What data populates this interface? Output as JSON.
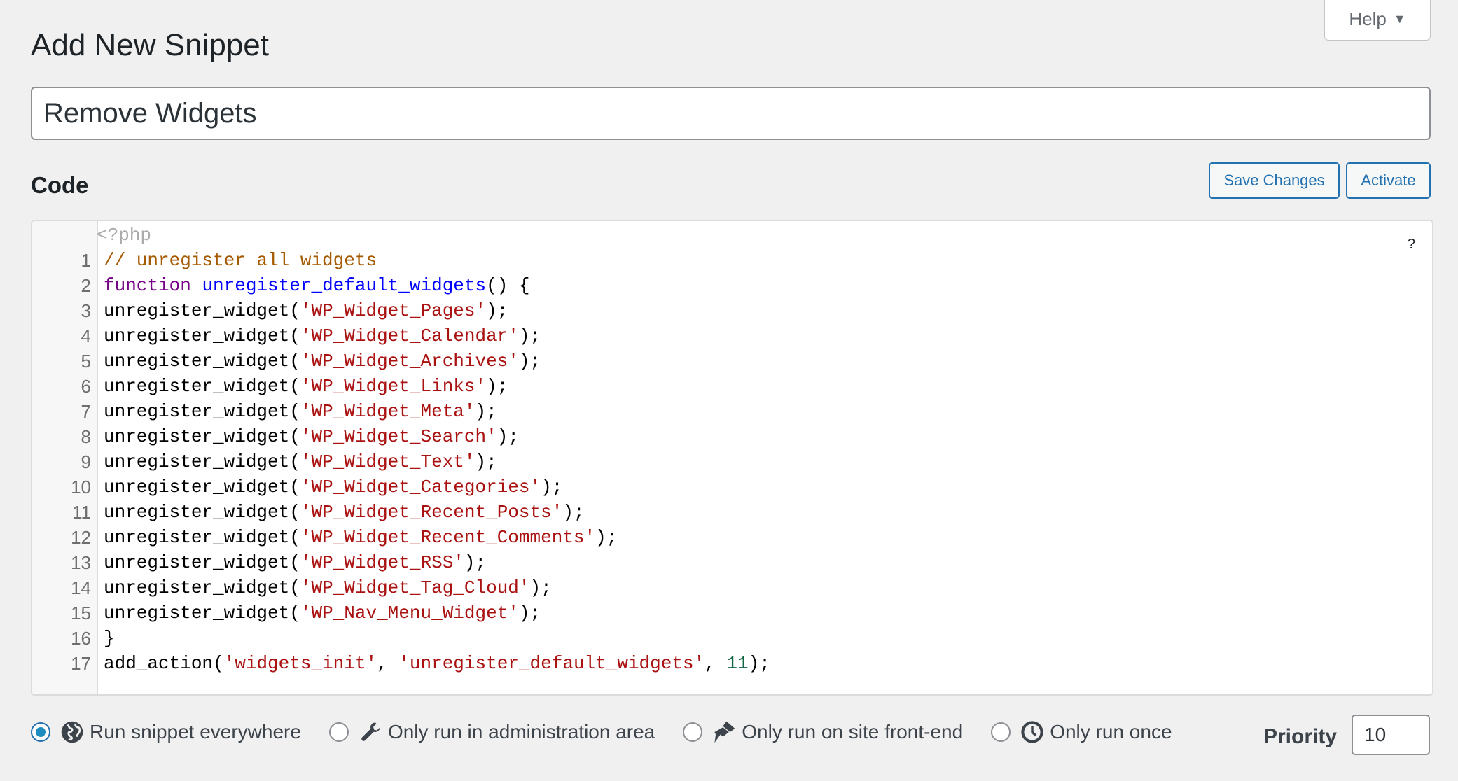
{
  "help": {
    "label": "Help",
    "arrow": "▼"
  },
  "page": {
    "title": "Add New Snippet"
  },
  "snippet": {
    "name": "Remove Widgets"
  },
  "code_section": {
    "heading": "Code",
    "save_label": "Save Changes",
    "activate_label": "Activate",
    "help_mark": "?"
  },
  "editor": {
    "opening_tag": "<?php",
    "lines": [
      {
        "n": "1",
        "tokens": [
          {
            "t": "// unregister all widgets",
            "c": "comment"
          }
        ]
      },
      {
        "n": "2",
        "tokens": [
          {
            "t": "function",
            "c": "keyword"
          },
          {
            "t": " ",
            "c": ""
          },
          {
            "t": "unregister_default_widgets",
            "c": "def"
          },
          {
            "t": "() {",
            "c": ""
          }
        ]
      },
      {
        "n": "3",
        "tokens": [
          {
            "t": "unregister_widget(",
            "c": ""
          },
          {
            "t": "'WP_Widget_Pages'",
            "c": "string"
          },
          {
            "t": ");",
            "c": ""
          }
        ]
      },
      {
        "n": "4",
        "tokens": [
          {
            "t": "unregister_widget(",
            "c": ""
          },
          {
            "t": "'WP_Widget_Calendar'",
            "c": "string"
          },
          {
            "t": ");",
            "c": ""
          }
        ]
      },
      {
        "n": "5",
        "tokens": [
          {
            "t": "unregister_widget(",
            "c": ""
          },
          {
            "t": "'WP_Widget_Archives'",
            "c": "string"
          },
          {
            "t": ");",
            "c": ""
          }
        ]
      },
      {
        "n": "6",
        "tokens": [
          {
            "t": "unregister_widget(",
            "c": ""
          },
          {
            "t": "'WP_Widget_Links'",
            "c": "string"
          },
          {
            "t": ");",
            "c": ""
          }
        ]
      },
      {
        "n": "7",
        "tokens": [
          {
            "t": "unregister_widget(",
            "c": ""
          },
          {
            "t": "'WP_Widget_Meta'",
            "c": "string"
          },
          {
            "t": ");",
            "c": ""
          }
        ]
      },
      {
        "n": "8",
        "tokens": [
          {
            "t": "unregister_widget(",
            "c": ""
          },
          {
            "t": "'WP_Widget_Search'",
            "c": "string"
          },
          {
            "t": ");",
            "c": ""
          }
        ]
      },
      {
        "n": "9",
        "tokens": [
          {
            "t": "unregister_widget(",
            "c": ""
          },
          {
            "t": "'WP_Widget_Text'",
            "c": "string"
          },
          {
            "t": ");",
            "c": ""
          }
        ]
      },
      {
        "n": "10",
        "tokens": [
          {
            "t": "unregister_widget(",
            "c": ""
          },
          {
            "t": "'WP_Widget_Categories'",
            "c": "string"
          },
          {
            "t": ");",
            "c": ""
          }
        ]
      },
      {
        "n": "11",
        "tokens": [
          {
            "t": "unregister_widget(",
            "c": ""
          },
          {
            "t": "'WP_Widget_Recent_Posts'",
            "c": "string"
          },
          {
            "t": ");",
            "c": ""
          }
        ]
      },
      {
        "n": "12",
        "tokens": [
          {
            "t": "unregister_widget(",
            "c": ""
          },
          {
            "t": "'WP_Widget_Recent_Comments'",
            "c": "string"
          },
          {
            "t": ");",
            "c": ""
          }
        ]
      },
      {
        "n": "13",
        "tokens": [
          {
            "t": "unregister_widget(",
            "c": ""
          },
          {
            "t": "'WP_Widget_RSS'",
            "c": "string"
          },
          {
            "t": ");",
            "c": ""
          }
        ]
      },
      {
        "n": "14",
        "tokens": [
          {
            "t": "unregister_widget(",
            "c": ""
          },
          {
            "t": "'WP_Widget_Tag_Cloud'",
            "c": "string"
          },
          {
            "t": ");",
            "c": ""
          }
        ]
      },
      {
        "n": "15",
        "tokens": [
          {
            "t": "unregister_widget(",
            "c": ""
          },
          {
            "t": "'WP_Nav_Menu_Widget'",
            "c": "string"
          },
          {
            "t": ");",
            "c": ""
          }
        ]
      },
      {
        "n": "16",
        "tokens": [
          {
            "t": "}",
            "c": ""
          }
        ]
      },
      {
        "n": "17",
        "tokens": [
          {
            "t": "add_action(",
            "c": ""
          },
          {
            "t": "'widgets_init'",
            "c": "string"
          },
          {
            "t": ", ",
            "c": ""
          },
          {
            "t": "'unregister_default_widgets'",
            "c": "string"
          },
          {
            "t": ", ",
            "c": ""
          },
          {
            "t": "11",
            "c": "number"
          },
          {
            "t": ");",
            "c": ""
          }
        ]
      }
    ]
  },
  "scope": {
    "options": [
      {
        "label": "Run snippet everywhere",
        "icon": "globe-icon",
        "checked": true
      },
      {
        "label": "Only run in administration area",
        "icon": "wrench-icon",
        "checked": false
      },
      {
        "label": "Only run on site front-end",
        "icon": "paintbrush-icon",
        "checked": false
      },
      {
        "label": "Only run once",
        "icon": "clock-icon",
        "checked": false
      }
    ]
  },
  "priority": {
    "label": "Priority",
    "value": "10"
  },
  "colors": {
    "accent": "#2271b1",
    "radio_fill": "#1e8cbe",
    "string": "#aa1111",
    "comment": "#a55a00",
    "keyword": "#770088",
    "def": "#0000ff",
    "number": "#116644"
  }
}
